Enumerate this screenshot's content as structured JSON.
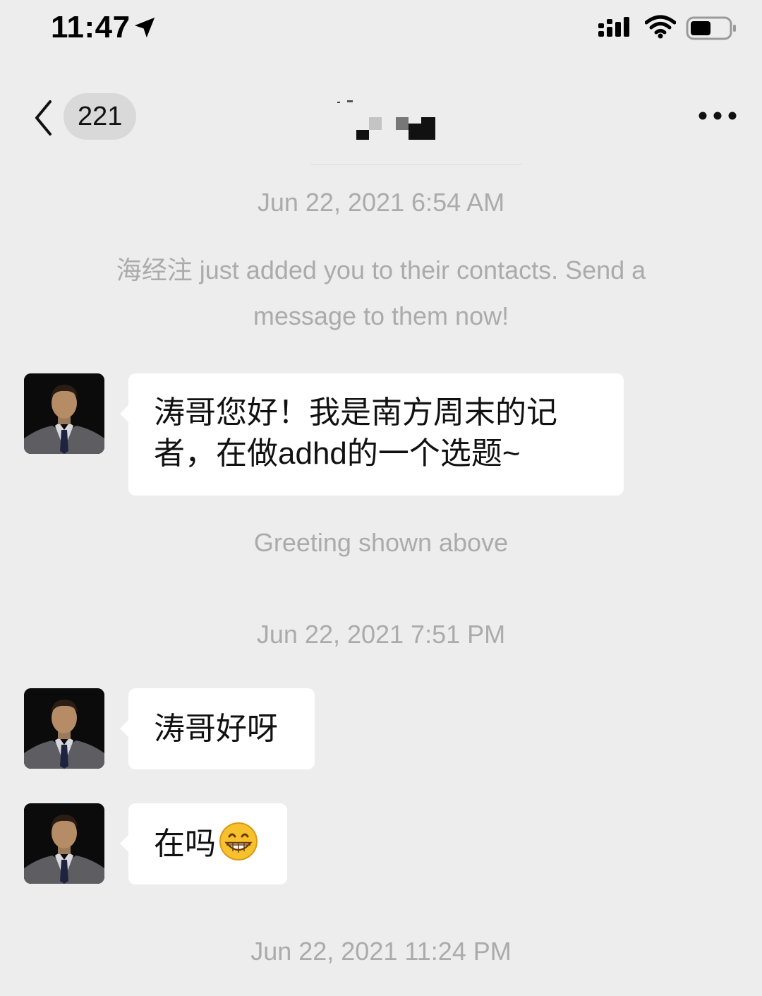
{
  "status_bar": {
    "time": "11:47"
  },
  "nav": {
    "back_badge": "221",
    "title": "",
    "more_icon": "more-dots-icon"
  },
  "messages": {
    "ts1": "Jun 22, 2021 6:54 AM",
    "system_note": "海经注 just added you to their contacts. Send a message to them now!",
    "msg1": "涛哥您好！我是南方周末的记者，在做adhd的一个选题~",
    "greeting_note": "Greeting shown above",
    "ts2": "Jun 22, 2021 7:51 PM",
    "msg2": "涛哥好呀",
    "msg3": "在吗",
    "msg3_emoji": "grinning-face-emoji",
    "ts3": "Jun 22, 2021 11:24 PM"
  },
  "colors": {
    "background": "#ededed",
    "bubble": "#ffffff",
    "meta_text": "#ababab",
    "badge": "#d9d9d9"
  }
}
